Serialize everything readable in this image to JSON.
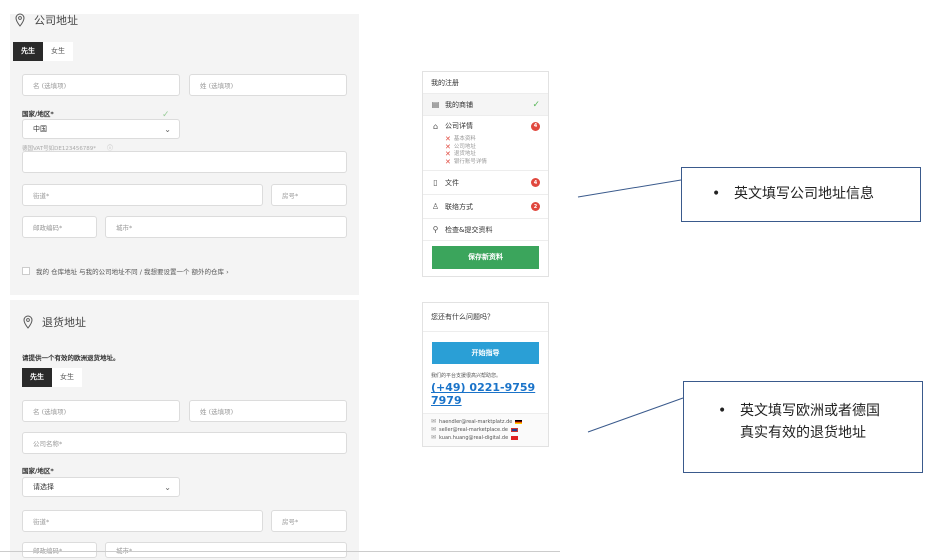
{
  "company_section": {
    "title": "公司地址",
    "salutation": {
      "active": "先生",
      "inactive": "女生"
    },
    "first_name_placeholder": "名 (选填项)",
    "last_name_placeholder": "姓 (选填项)",
    "country_label": "国家/地区*",
    "country_value": "中国",
    "vat_label": "德国VAT号如DE123456789*",
    "street_placeholder": "街道*",
    "house_no_placeholder": "房号*",
    "zip_placeholder": "邮政编码*",
    "city_placeholder": "城市*",
    "warehouse_checkbox_text": "我的 仓库地址 与我的公司地址不同 / 我想要设置一个 额外的仓库 ›"
  },
  "return_section": {
    "title": "退货地址",
    "instruction": "请提供一个有效的欧洲退货地址。",
    "salutation": {
      "active": "先生",
      "inactive": "女生"
    },
    "first_name_placeholder": "名 (选填项)",
    "last_name_placeholder": "姓 (选填项)",
    "company_name_placeholder": "公司名称*",
    "country_label": "国家/地区*",
    "country_value": "请选择",
    "street_placeholder": "街道*",
    "house_no_placeholder": "房号*",
    "zip_placeholder": "邮政编码*",
    "city_placeholder": "城市*"
  },
  "sidebar": {
    "title": "我的注册",
    "items": [
      {
        "label": "我的商铺",
        "icon": "store-icon",
        "status": "✓"
      },
      {
        "label": "公司详情",
        "icon": "home-icon",
        "badge": "4",
        "sub": [
          "基本资料",
          "公司地址",
          "退货地址",
          "银行账号详情"
        ]
      },
      {
        "label": "文件",
        "icon": "file-icon",
        "badge": "4"
      },
      {
        "label": "联络方式",
        "icon": "user-icon",
        "badge": "2"
      },
      {
        "label": "检查&提交资料",
        "icon": "search-icon"
      }
    ],
    "save_button": "保存新资料"
  },
  "help": {
    "title": "您还有什么问题吗？",
    "button": "开始指导",
    "note": "我们的平台支援很高兴帮助您。",
    "phone": "(+49) 0221-9759 7979",
    "emails": [
      {
        "address": "haendler@real-marktplatz.de",
        "flag": "de"
      },
      {
        "address": "seller@real-marketplace.de",
        "flag": "gb"
      },
      {
        "address": "kuan.huang@real-digital.de",
        "flag": "cn"
      }
    ]
  },
  "annotations": {
    "company": "英文填写公司地址信息",
    "return_line1": "英文填写欧洲或者德国",
    "return_line2": "真实有效的退货地址"
  },
  "colors": {
    "save_green": "#3ba55c",
    "guide_blue": "#2a9fd6",
    "badge_red": "#e0483e",
    "phone_link": "#1a73c9"
  }
}
